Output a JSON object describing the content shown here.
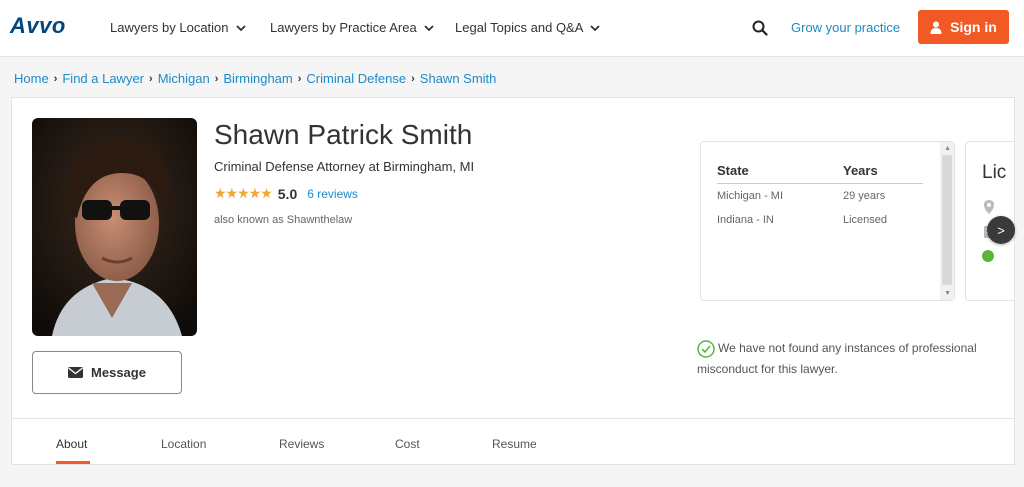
{
  "header": {
    "logo": "Avvo",
    "nav": [
      {
        "label": "Lawyers by Location"
      },
      {
        "label": "Lawyers by Practice Area"
      },
      {
        "label": "Legal Topics and Q&A"
      }
    ],
    "grow_link": "Grow your practice",
    "signin_label": "Sign in"
  },
  "breadcrumb": [
    "Home",
    "Find a Lawyer",
    "Michigan",
    "Birmingham",
    "Criminal Defense",
    "Shawn Smith"
  ],
  "profile": {
    "name": "Shawn Patrick Smith",
    "subtitle": "Criminal Defense Attorney at Birmingham, MI",
    "stars": "★★★★★",
    "rating": "5.0",
    "reviews": "6 reviews",
    "aka": "also known as Shawnthelaw",
    "message_label": "Message"
  },
  "licenses": {
    "col_state": "State",
    "col_years": "Years",
    "rows": [
      {
        "state": "Michigan - MI",
        "years": "29 years"
      },
      {
        "state": "Indiana - IN",
        "years": "Licensed"
      }
    ],
    "next_card_title": "Lic",
    "next_label": ">"
  },
  "misconduct_text": "We have not found any instances of professional misconduct for this lawyer.",
  "tabs": [
    {
      "label": "About"
    },
    {
      "label": "Location"
    },
    {
      "label": "Reviews"
    },
    {
      "label": "Cost"
    },
    {
      "label": "Resume"
    }
  ],
  "colors": {
    "brand_blue": "#00467f",
    "link_blue": "#1d8ac7",
    "accent_orange": "#f15a24",
    "star": "#f0a734",
    "status_green": "#5bb53b"
  }
}
